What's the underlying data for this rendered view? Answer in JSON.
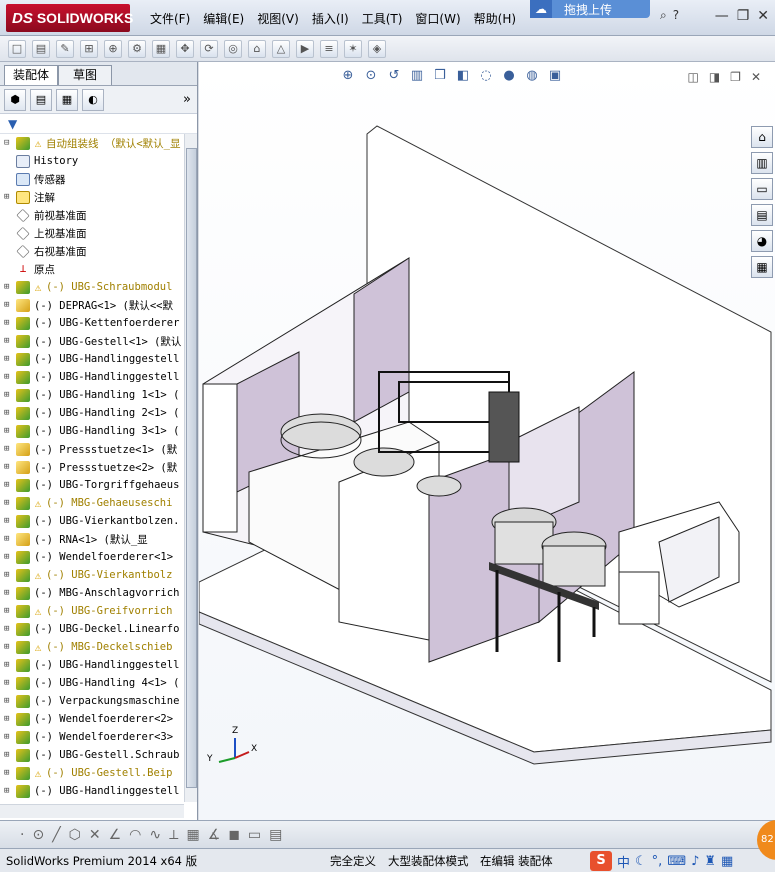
{
  "app": {
    "logo_prefix": "DS",
    "logo_text": "SOLIDWORKS",
    "upload_label": "拖拽上传"
  },
  "menu": [
    "文件(F)",
    "编辑(E)",
    "视图(V)",
    "插入(I)",
    "工具(T)",
    "窗口(W)",
    "帮助(H)"
  ],
  "tabs": [
    "装配体",
    "草图"
  ],
  "feature_tree": {
    "root": "自动组装线 （默认<默认_显",
    "items": [
      {
        "label": "History",
        "icon": "history-icon"
      },
      {
        "label": "传感器",
        "icon": "sensor-icon"
      },
      {
        "label": "注解",
        "icon": "annotation-icon"
      },
      {
        "label": "前视基准面",
        "icon": "plane-icon"
      },
      {
        "label": "上视基准面",
        "icon": "plane-icon"
      },
      {
        "label": "右视基准面",
        "icon": "plane-icon"
      },
      {
        "label": "原点",
        "icon": "origin-icon"
      },
      {
        "label": "(-) UBG-Schraubmodul",
        "icon": "assembly-icon",
        "warn": true
      },
      {
        "label": "(-) DEPRAG<1> (默认<<默",
        "icon": "part-icon"
      },
      {
        "label": "(-) UBG-Kettenfoerderer",
        "icon": "assembly-icon"
      },
      {
        "label": "(-) UBG-Gestell<1> (默认",
        "icon": "assembly-icon"
      },
      {
        "label": "(-) UBG-Handlinggestell",
        "icon": "assembly-icon"
      },
      {
        "label": "(-) UBG-Handlinggestell",
        "icon": "assembly-icon"
      },
      {
        "label": "(-) UBG-Handling 1<1> (",
        "icon": "assembly-icon"
      },
      {
        "label": "(-) UBG-Handling 2<1> (",
        "icon": "assembly-icon"
      },
      {
        "label": "(-) UBG-Handling 3<1> (",
        "icon": "assembly-icon"
      },
      {
        "label": "(-) Pressstuetze<1> (默",
        "icon": "part-icon"
      },
      {
        "label": "(-) Pressstuetze<2> (默",
        "icon": "part-icon"
      },
      {
        "label": "(-) UBG-Torgriffgehaeus",
        "icon": "assembly-icon"
      },
      {
        "label": "(-) MBG-Gehaeuseschi",
        "icon": "assembly-icon",
        "warn": true
      },
      {
        "label": "(-) UBG-Vierkantbolzen.",
        "icon": "assembly-icon"
      },
      {
        "label": "(-) RNA<1> (默认_显",
        "icon": "part-icon"
      },
      {
        "label": "(-) Wendelfoerderer<1>",
        "icon": "assembly-icon"
      },
      {
        "label": "(-) UBG-Vierkantbolz",
        "icon": "assembly-icon",
        "warn": true
      },
      {
        "label": "(-) MBG-Anschlagvorrich",
        "icon": "assembly-icon"
      },
      {
        "label": "(-) UBG-Greifvorrich",
        "icon": "assembly-icon",
        "warn": true
      },
      {
        "label": "(-) UBG-Deckel.Linearfo",
        "icon": "assembly-icon"
      },
      {
        "label": "(-) MBG-Deckelschieb",
        "icon": "assembly-icon",
        "warn": true
      },
      {
        "label": "(-) UBG-Handlinggestell",
        "icon": "assembly-icon"
      },
      {
        "label": "(-) UBG-Handling 4<1> (",
        "icon": "assembly-icon"
      },
      {
        "label": "(-) Verpackungsmaschine",
        "icon": "assembly-icon"
      },
      {
        "label": "(-) Wendelfoerderer<2>",
        "icon": "assembly-icon"
      },
      {
        "label": "(-) Wendelfoerderer<3>",
        "icon": "assembly-icon"
      },
      {
        "label": "(-) UBG-Gestell.Schraub",
        "icon": "assembly-icon"
      },
      {
        "label": "(-) UBG-Gestell.Beip",
        "icon": "assembly-icon",
        "warn": true
      },
      {
        "label": "(-) UBG-Handlinggestell",
        "icon": "assembly-icon"
      }
    ]
  },
  "triad": {
    "x": "X",
    "y": "Y",
    "z": "Z"
  },
  "status": {
    "product": "SolidWorks Premium 2014 x64 版",
    "defined": "完全定义",
    "mode": "大型装配体模式",
    "editing": "在编辑 装配体"
  },
  "ime": {
    "brand": "S",
    "lang": "中"
  },
  "badge": "82"
}
